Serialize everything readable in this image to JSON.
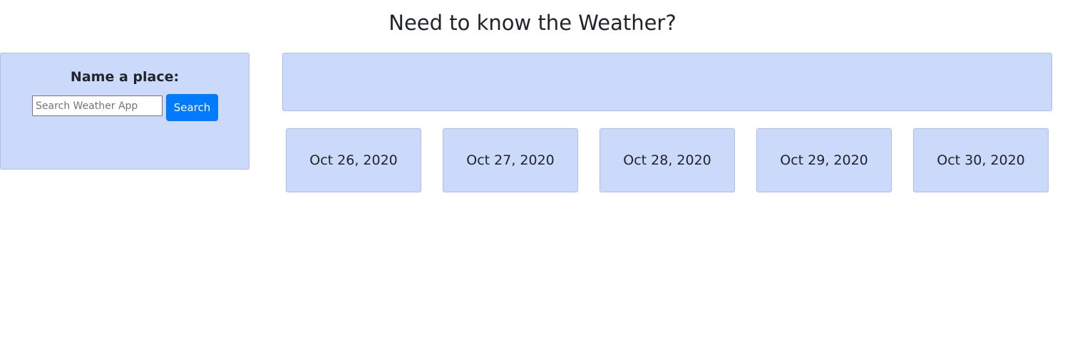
{
  "header": {
    "title": "Need to know the Weather?"
  },
  "search": {
    "heading": "Name a place:",
    "input_value": "",
    "placeholder": "Search Weather App",
    "button_label": "Search"
  },
  "current_weather": {},
  "forecast": [
    {
      "date": "Oct 26, 2020"
    },
    {
      "date": "Oct 27, 2020"
    },
    {
      "date": "Oct 28, 2020"
    },
    {
      "date": "Oct 29, 2020"
    },
    {
      "date": "Oct 30, 2020"
    }
  ],
  "colors": {
    "panel_background": "#cbd9fa",
    "button_primary": "#007bff"
  }
}
